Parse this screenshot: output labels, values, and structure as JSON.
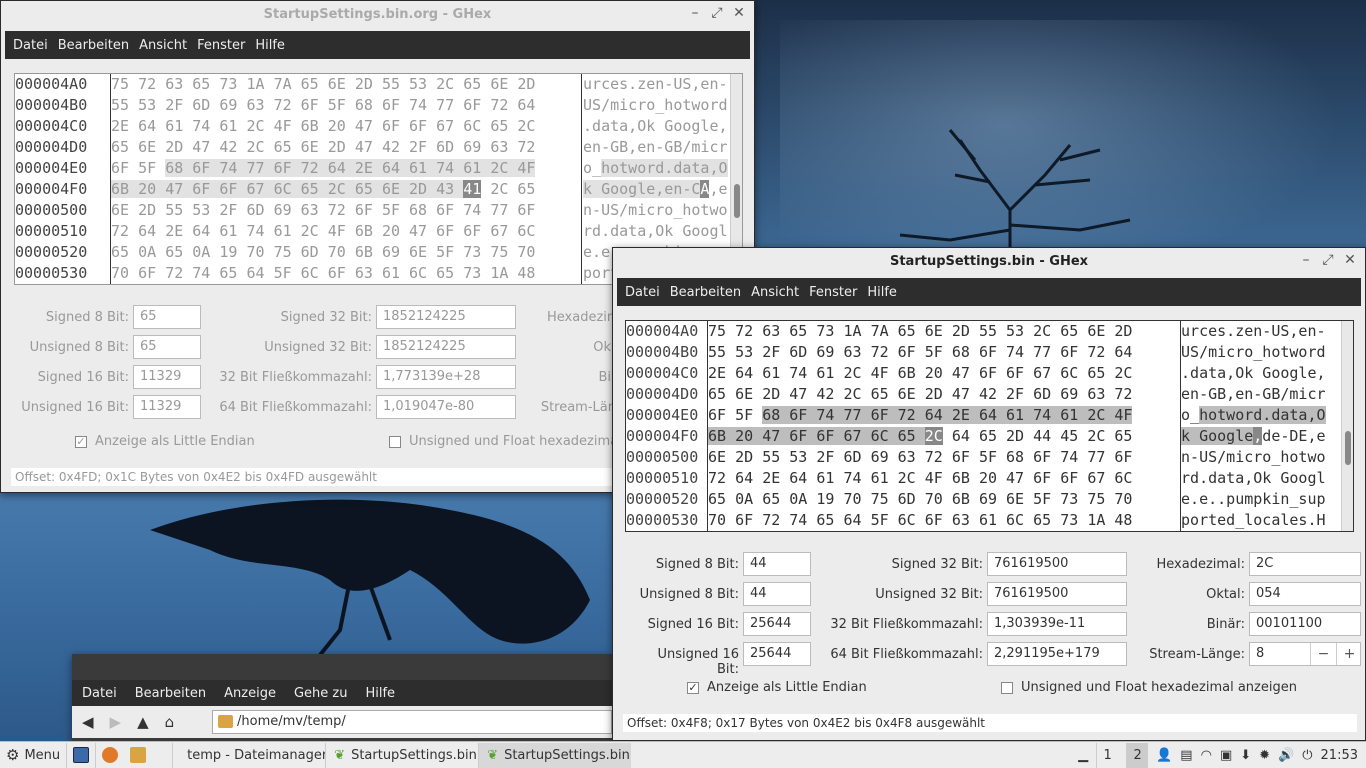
{
  "window_bg": {
    "title": "StartupSettings.bin.org - GHex",
    "menu": [
      "Datei",
      "Bearbeiten",
      "Ansicht",
      "Fenster",
      "Hilfe"
    ],
    "hex_rows": [
      {
        "addr": "000004A0",
        "hex": "75 72 63 65 73 1A 7A 65 6E 2D 55 53 2C 65 6E 2D",
        "ascii": "urces.zen-US,en-"
      },
      {
        "addr": "000004B0",
        "hex": "55 53 2F 6D 69 63 72 6F 5F 68 6F 74 77 6F 72 64",
        "ascii": "US/micro_hotword"
      },
      {
        "addr": "000004C0",
        "hex": "2E 64 61 74 61 2C 4F 6B 20 47 6F 6F 67 6C 65 2C",
        "ascii": ".data,Ok Google,"
      },
      {
        "addr": "000004D0",
        "hex": "65 6E 2D 47 42 2C 65 6E 2D 47 42 2F 6D 69 63 72",
        "ascii": "en-GB,en-GB/micr"
      },
      {
        "addr": "000004E0",
        "hex": "6F 5F 68 6F 74 77 6F 72 64 2E 64 61 74 61 2C 4F",
        "ascii": "o_hotword.data,O"
      },
      {
        "addr": "000004F0",
        "hex": "6B 20 47 6F 6F 67 6C 65 2C 65 6E 2D 43 41 2C 65",
        "ascii": "k Google,en-CA,e"
      },
      {
        "addr": "00000500",
        "hex": "6E 2D 55 53 2F 6D 69 63 72 6F 5F 68 6F 74 77 6F",
        "ascii": "n-US/micro_hotwo"
      },
      {
        "addr": "00000510",
        "hex": "72 64 2E 64 61 74 61 2C 4F 6B 20 47 6F 6F 67 6C",
        "ascii": "rd.data,Ok Googl"
      },
      {
        "addr": "00000520",
        "hex": "65 0A 65 0A 19 70 75 6D 70 6B 69 6E 5F 73 75 70",
        "ascii": "e.e..pumpkin_sup"
      },
      {
        "addr": "00000530",
        "hex": "70 6F 72 74 65 64 5F 6C 6F 63 61 6C 65 73 1A 48",
        "ascii": "ported_locales.H"
      }
    ],
    "fields": {
      "signed8_label": "Signed 8 Bit:",
      "signed8": "65",
      "unsigned8_label": "Unsigned 8 Bit:",
      "unsigned8": "65",
      "signed16_label": "Signed 16 Bit:",
      "signed16": "11329",
      "unsigned16_label": "Unsigned 16 Bit:",
      "unsigned16": "11329",
      "signed32_label": "Signed 32 Bit:",
      "signed32": "1852124225",
      "unsigned32_label": "Unsigned 32 Bit:",
      "unsigned32": "1852124225",
      "float32_label": "32 Bit Fließkommazahl:",
      "float32": "1,773139e+28",
      "float64_label": "64 Bit Fließkommazahl:",
      "float64": "1,019047e-80",
      "hex_label": "Hexadezim",
      "oct_label": "Ok",
      "bin_label": "Bi",
      "stream_label": "Stream-Län"
    },
    "little_endian": "Anzeige als Little Endian",
    "unsigned_float": "Unsigned und Float hexadezimal",
    "status": "Offset: 0x4FD; 0x1C Bytes von 0x4E2 bis 0x4FD ausgewählt"
  },
  "window_fg": {
    "title": "StartupSettings.bin - GHex",
    "menu": [
      "Datei",
      "Bearbeiten",
      "Ansicht",
      "Fenster",
      "Hilfe"
    ],
    "hex_rows": [
      {
        "addr": "000004A0",
        "hex": "75 72 63 65 73 1A 7A 65 6E 2D 55 53 2C 65 6E 2D",
        "ascii": "urces.zen-US,en-"
      },
      {
        "addr": "000004B0",
        "hex": "55 53 2F 6D 69 63 72 6F 5F 68 6F 74 77 6F 72 64",
        "ascii": "US/micro_hotword"
      },
      {
        "addr": "000004C0",
        "hex": "2E 64 61 74 61 2C 4F 6B 20 47 6F 6F 67 6C 65 2C",
        "ascii": ".data,Ok Google,"
      },
      {
        "addr": "000004D0",
        "hex": "65 6E 2D 47 42 2C 65 6E 2D 47 42 2F 6D 69 63 72",
        "ascii": "en-GB,en-GB/micr"
      },
      {
        "addr": "000004E0",
        "hex": "6F 5F 68 6F 74 77 6F 72 64 2E 64 61 74 61 2C 4F",
        "ascii": "o_hotword.data,O"
      },
      {
        "addr": "000004F0",
        "hex": "6B 20 47 6F 6F 67 6C 65 2C 64 65 2D 44 45 2C 65",
        "ascii": "k Google,de-DE,e"
      },
      {
        "addr": "00000500",
        "hex": "6E 2D 55 53 2F 6D 69 63 72 6F 5F 68 6F 74 77 6F",
        "ascii": "n-US/micro_hotwo"
      },
      {
        "addr": "00000510",
        "hex": "72 64 2E 64 61 74 61 2C 4F 6B 20 47 6F 6F 67 6C",
        "ascii": "rd.data,Ok Googl"
      },
      {
        "addr": "00000520",
        "hex": "65 0A 65 0A 19 70 75 6D 70 6B 69 6E 5F 73 75 70",
        "ascii": "e.e..pumpkin_sup"
      },
      {
        "addr": "00000530",
        "hex": "70 6F 72 74 65 64 5F 6C 6F 63 61 6C 65 73 1A 48",
        "ascii": "ported_locales.H"
      }
    ],
    "fields": {
      "signed8_label": "Signed 8 Bit:",
      "signed8": "44",
      "unsigned8_label": "Unsigned 8 Bit:",
      "unsigned8": "44",
      "signed16_label": "Signed 16 Bit:",
      "signed16": "25644",
      "unsigned16_label": "Unsigned 16 Bit:",
      "unsigned16": "25644",
      "signed32_label": "Signed 32 Bit:",
      "signed32": "761619500",
      "unsigned32_label": "Unsigned 32 Bit:",
      "unsigned32": "761619500",
      "float32_label": "32 Bit Fließkommazahl:",
      "float32": "1,303939e-11",
      "float64_label": "64 Bit Fließkommazahl:",
      "float64": "2,291195e+179",
      "hex_label": "Hexadezimal:",
      "hex": "2C",
      "oct_label": "Oktal:",
      "oct": "054",
      "bin_label": "Binär:",
      "bin": "00101100",
      "stream_label": "Stream-Länge:",
      "stream": "8"
    },
    "little_endian": "Anzeige als Little Endian",
    "unsigned_float": "Unsigned und Float hexadezimal anzeigen",
    "status": "Offset: 0x4F8; 0x17 Bytes von 0x4E2 bis 0x4F8 ausgewählt"
  },
  "file_manager": {
    "menu": [
      "Datei",
      "Bearbeiten",
      "Anzeige",
      "Gehe zu",
      "Hilfe"
    ],
    "path": "/home/mv/temp/"
  },
  "taskbar": {
    "menu_label": "Menu",
    "tasks": [
      "temp - Dateimanager",
      "StartupSettings.bin.or...",
      "StartupSettings.bin - ..."
    ],
    "workspaces": [
      "1",
      "2"
    ],
    "clock": "21:53"
  }
}
